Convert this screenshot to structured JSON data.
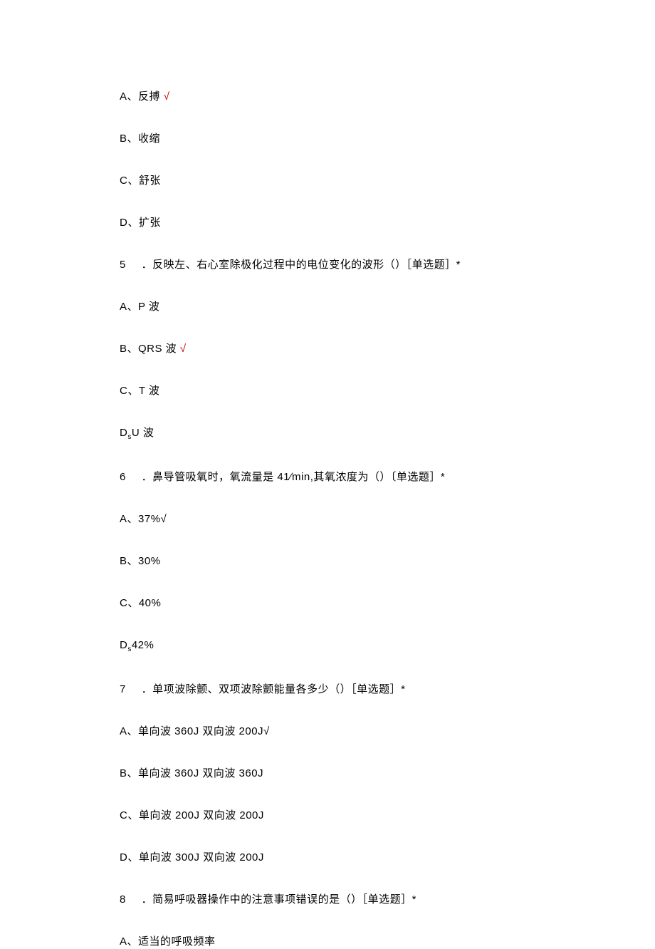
{
  "lines": {
    "l1_prefix": "A、",
    "l1_text": "反搏",
    "l1_mark": "√",
    "l2": "B、收缩",
    "l3": "C、舒张",
    "l4": "D、扩张",
    "l5_num": "5",
    "l5_text": " ．反映左、右心室除极化过程中的电位变化的波形（）［单选题］*",
    "l6": "A、P 波",
    "l7_prefix": "B、QRS 波",
    "l7_mark": "√",
    "l8": "C、T 波",
    "l9_a": "D",
    "l9_sub": "s",
    "l9_b": "U 波",
    "l10_num": "6",
    "l10_text": " ．鼻导管吸氧时，氧流量是 41∕min,其氧浓度为（）〔单选题］*",
    "l11": "A、37%√",
    "l12": "B、30%",
    "l13": "C、40%",
    "l14_a": "D",
    "l14_sub": "s",
    "l14_b": "42%",
    "l15_num": "7",
    "l15_text": " ．单项波除颤、双项波除颤能量各多少（）［单选题］*",
    "l16": "A、单向波 360J 双向波 200J√",
    "l17": "B、单向波 360J 双向波 360J",
    "l18": "C、单向波 200J 双向波 200J",
    "l19": "D、单向波 300J 双向波 200J",
    "l20_num": "8",
    "l20_text": " ．简易呼吸器操作中的注意事项错误的是（）［单选题］*",
    "l21": "A、适当的呼吸频率"
  }
}
